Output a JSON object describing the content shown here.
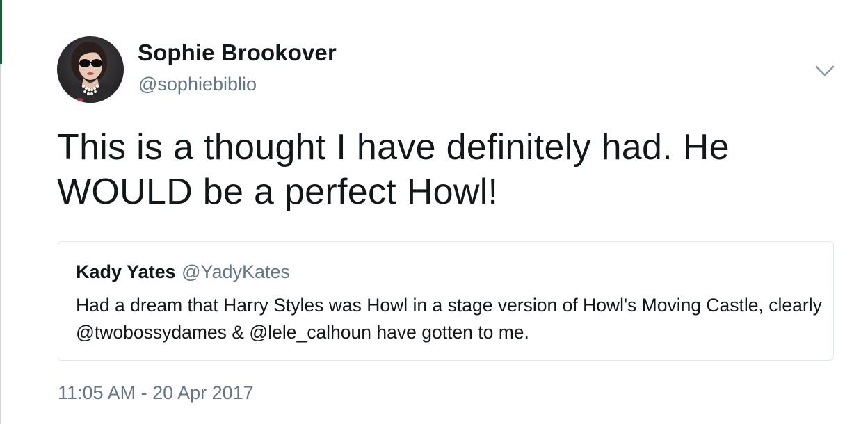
{
  "tweet": {
    "author_name": "Sophie Brookover",
    "author_handle": "@sophiebiblio",
    "text": "This is a thought I have definitely had. He WOULD be a perfect Howl!",
    "timestamp": "11:05 AM - 20 Apr 2017",
    "menu_icon": "chevron-down-icon",
    "avatar_icon": "avatar"
  },
  "quoted_tweet": {
    "author_name": "Kady Yates",
    "author_handle": "@YadyKates",
    "text": "Had a dream that Harry Styles was Howl in a stage version of Howl's Moving Castle, clearly @twobossydames & @lele_calhoun have gotten to me."
  },
  "colors": {
    "text_primary": "#14171a",
    "text_secondary": "#657786",
    "border": "#e1e8ed",
    "edge_accent": "#1d5a3a"
  }
}
